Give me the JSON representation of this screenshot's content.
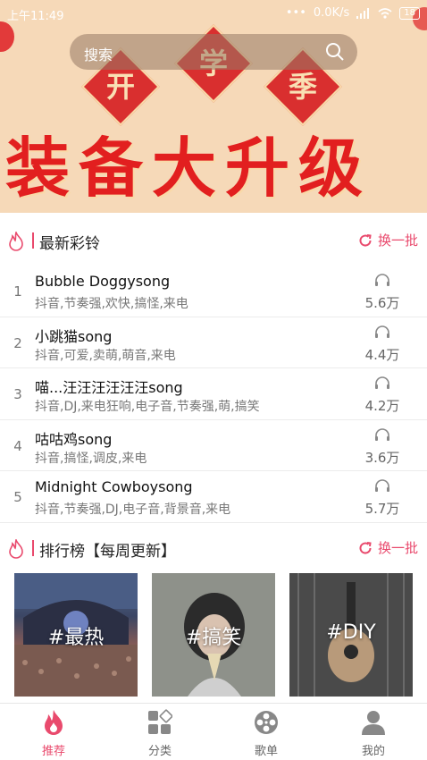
{
  "status_bar": {
    "time": "上午11:49",
    "network": "0.0K/s",
    "battery": "18"
  },
  "search": {
    "placeholder": "搜索"
  },
  "banner": {
    "badge_chars": [
      "开",
      "学",
      "季"
    ],
    "headline": "装备大升级"
  },
  "sections": {
    "new_ringtones": {
      "title": "最新彩铃",
      "refresh_label": "换一批"
    },
    "ranking": {
      "title": "排行榜【每周更新】",
      "refresh_label": "换一批"
    }
  },
  "songs": [
    {
      "index": "1",
      "name": "Bubble Doggysong",
      "tags": "抖音,节奏强,欢快,搞怪,来电",
      "plays": "5.6万"
    },
    {
      "index": "2",
      "name": "小跳猫song",
      "tags": "抖音,可爱,卖萌,萌音,来电",
      "plays": "4.4万"
    },
    {
      "index": "3",
      "name": "喵...汪汪汪汪汪汪song",
      "tags": "抖音,DJ,来电狂响,电子音,节奏强,萌,搞笑",
      "plays": "4.2万"
    },
    {
      "index": "4",
      "name": "咕咕鸡song",
      "tags": "抖音,搞怪,调皮,来电",
      "plays": "3.6万"
    },
    {
      "index": "5",
      "name": "Midnight Cowboysong",
      "tags": "抖音,节奏强,DJ,电子音,背景音,来电",
      "plays": "5.7万"
    }
  ],
  "rank_cards": [
    {
      "label": "#最热"
    },
    {
      "label": "#搞笑"
    },
    {
      "label": "#DIY"
    }
  ],
  "bottom_nav": [
    {
      "label": "推荐",
      "icon": "flame-icon",
      "active": true
    },
    {
      "label": "分类",
      "icon": "category-icon",
      "active": false
    },
    {
      "label": "歌单",
      "icon": "film-reel-icon",
      "active": false
    },
    {
      "label": "我的",
      "icon": "user-icon",
      "active": false
    }
  ],
  "colors": {
    "accent": "#e94a6d",
    "banner_red": "#e21f1f",
    "banner_bg": "#f6d9b8"
  }
}
